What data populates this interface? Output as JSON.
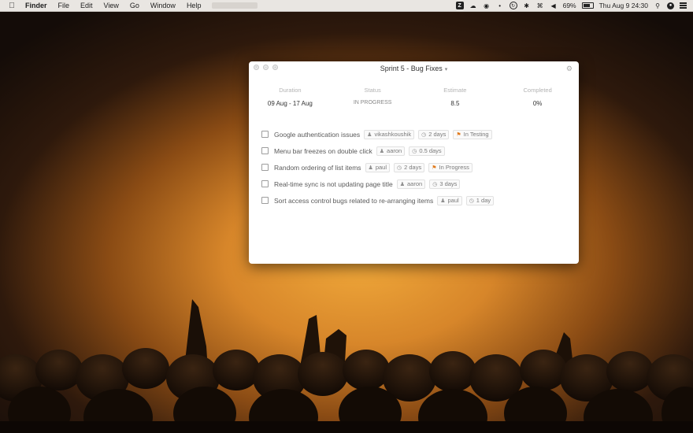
{
  "menubar": {
    "app_name": "Finder",
    "items": [
      "File",
      "Edit",
      "View",
      "Go",
      "Window",
      "Help"
    ],
    "status": {
      "battery_pct": "69%",
      "battery_level": 0.69,
      "datetime": "Thu Aug 9 24:30"
    },
    "icons": [
      "apple-icon",
      "z-app-icon",
      "cloud-icon",
      "camera-icon",
      "dot-icon",
      "sync-icon",
      "bluetooth-icon",
      "wifi-icon",
      "volume-icon",
      "search-icon",
      "siri-icon",
      "notification-center-icon"
    ]
  },
  "window": {
    "title": "Sprint 5 - Bug Fixes",
    "stats": [
      {
        "label": "Duration",
        "value": "09 Aug - 17 Aug"
      },
      {
        "label": "Status",
        "value": "IN PROGRESS"
      },
      {
        "label": "Estimate",
        "value": "8.5"
      },
      {
        "label": "Completed",
        "value": "0%"
      }
    ],
    "tasks": [
      {
        "title": "Google authentication issues",
        "assignee": "vikashkoushik",
        "estimate": "2 days",
        "status": "In Testing"
      },
      {
        "title": "Menu bar freezes on double click",
        "assignee": "aaron",
        "estimate": "0.5 days"
      },
      {
        "title": "Random ordering of list items",
        "assignee": "paul",
        "estimate": "2 days",
        "status": "In Progress"
      },
      {
        "title": "Real-time sync is not updating page title",
        "assignee": "aaron",
        "estimate": "3 days"
      },
      {
        "title": "Sort access control bugs related to re-arranging items",
        "assignee": "paul",
        "estimate": "1 day"
      }
    ]
  },
  "colors": {
    "flag": "#e07a1c",
    "wallpaper_glow": "#f0a83a"
  }
}
